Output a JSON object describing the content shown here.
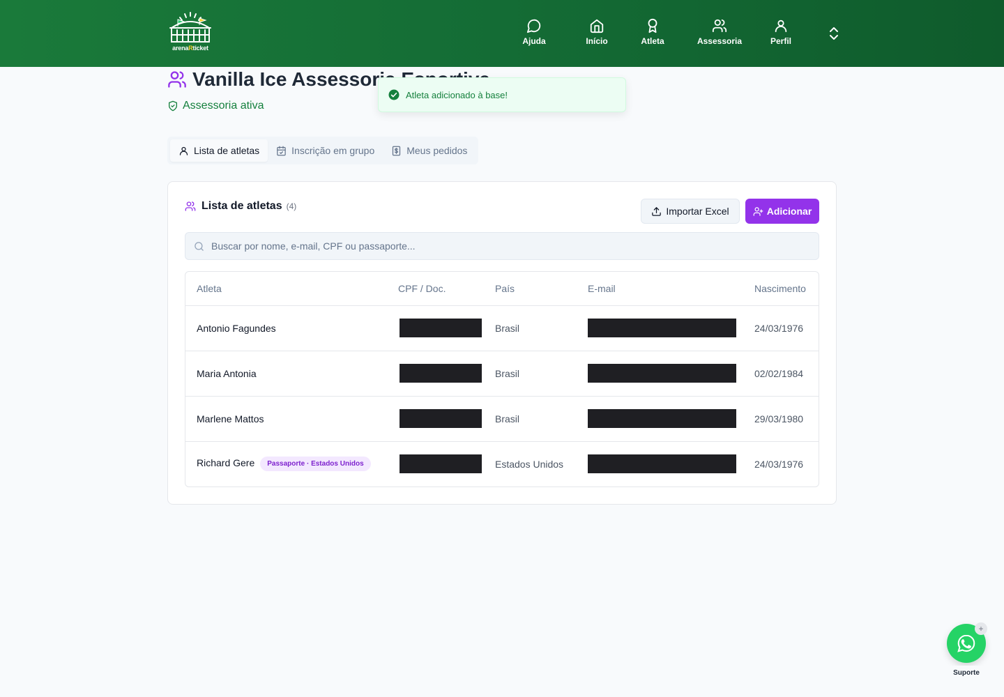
{
  "header": {
    "logo_text_start": "arena",
    "logo_text_mid": "R",
    "logo_text_end": "ticket",
    "nav": [
      {
        "label": "Ajuda",
        "icon": "message-circle-icon"
      },
      {
        "label": "Início",
        "icon": "home-icon"
      },
      {
        "label": "Atleta",
        "icon": "award-icon"
      },
      {
        "label": "Assessoria",
        "icon": "users-icon"
      },
      {
        "label": "Perfil",
        "icon": "user-icon"
      }
    ]
  },
  "page": {
    "title": "Vanilla Ice Assessoria Esportiva",
    "status": "Assessoria ativa"
  },
  "toast": {
    "message": "Atleta adicionado à base!"
  },
  "tabs": [
    {
      "label": "Lista de atletas",
      "active": true
    },
    {
      "label": "Inscrição em grupo",
      "active": false
    },
    {
      "label": "Meus pedidos",
      "active": false
    }
  ],
  "card": {
    "title": "Lista de atletas",
    "count": "(4)",
    "import_label": "Importar Excel",
    "add_label": "Adicionar",
    "search_placeholder": "Buscar por nome, e-mail, CPF ou passaporte..."
  },
  "table": {
    "columns": [
      "Atleta",
      "CPF / Doc.",
      "País",
      "E-mail",
      "Nascimento"
    ],
    "rows": [
      {
        "name": "Antonio Fagundes",
        "badge": "",
        "country": "Brasil",
        "birth": "24/03/1976"
      },
      {
        "name": "Maria Antonia",
        "badge": "",
        "country": "Brasil",
        "birth": "02/02/1984"
      },
      {
        "name": "Marlene Mattos",
        "badge": "",
        "country": "Brasil",
        "birth": "29/03/1980"
      },
      {
        "name": "Richard Gere",
        "badge": "Passaporte · Estados Unidos",
        "country": "Estados Unidos",
        "birth": "24/03/1976"
      }
    ]
  },
  "support": {
    "label": "Suporte"
  },
  "colors": {
    "header_green": "#146c35",
    "accent_purple": "#9333ea",
    "success_green": "#15803d"
  }
}
